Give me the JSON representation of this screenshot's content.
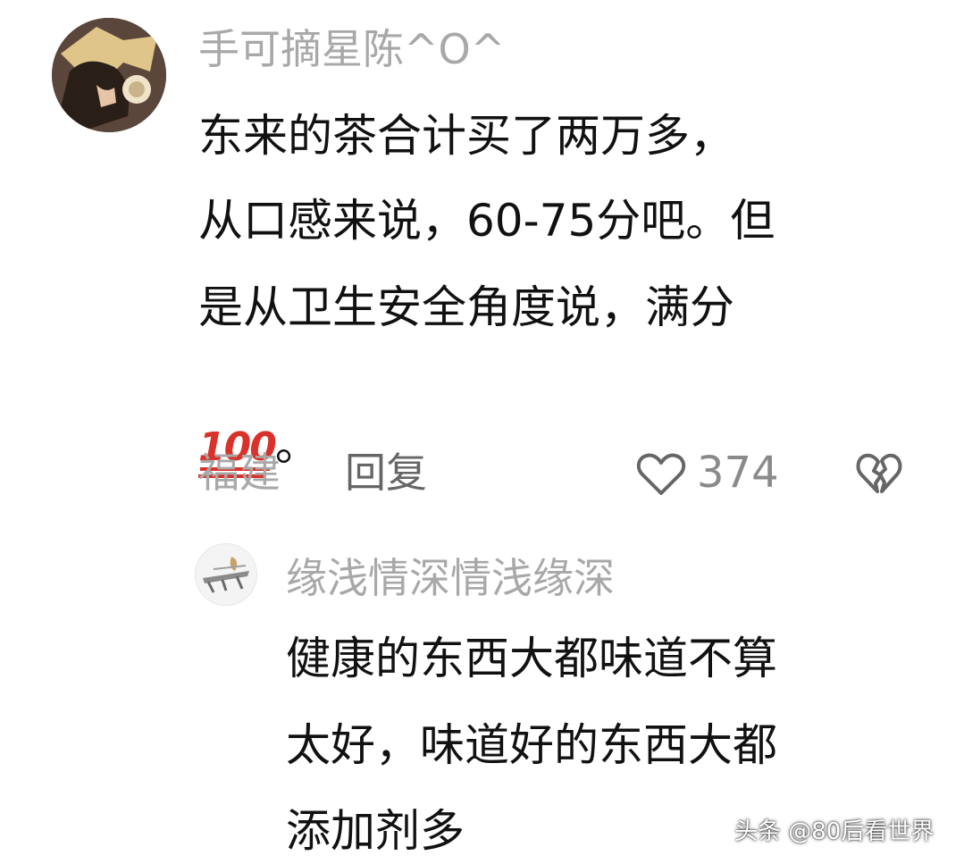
{
  "comment": {
    "username": "手可摘星陈^O^",
    "text_lines": [
      "东来的茶合计买了两万多，",
      "从口感来说，60-75分吧。但",
      "是从卫生安全角度说，满分"
    ],
    "emoji": "💯",
    "trailing": "。",
    "location": "福建",
    "reply_label": "回复",
    "like_count": "374",
    "like_icon": "heart-outline-icon",
    "dislike_icon": "broken-heart-icon"
  },
  "reply": {
    "username": "缘浅情深情浅缘深",
    "text_lines": [
      "健康的东西大都味道不算",
      "太好，味道好的东西大都",
      "添加剂多"
    ]
  },
  "watermark": "头条 @80后看世界"
}
